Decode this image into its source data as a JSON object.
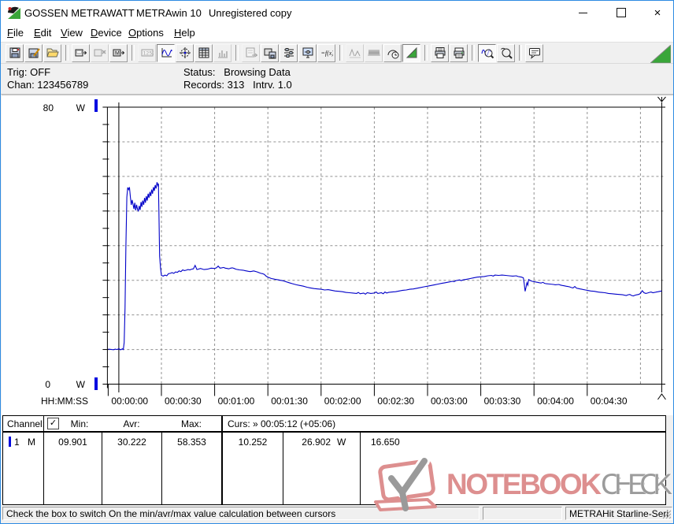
{
  "window": {
    "title_app": "GOSSEN METRAWATT",
    "title_product": "METRAwin 10",
    "title_status": "Unregistered copy"
  },
  "menu": {
    "items": [
      {
        "label": "File"
      },
      {
        "label": "Edit"
      },
      {
        "label": "View"
      },
      {
        "label": "Device"
      },
      {
        "label": "Options"
      },
      {
        "label": "Help"
      }
    ]
  },
  "toolbar": {
    "groups": [
      [
        {
          "name": "save"
        },
        {
          "name": "save-as"
        },
        {
          "name": "open"
        }
      ],
      [
        {
          "name": "device-read"
        },
        {
          "name": "device-disconnect",
          "disabled": true
        },
        {
          "name": "device-memory"
        }
      ],
      [
        {
          "name": "numeric-display",
          "disabled": true
        },
        {
          "name": "waveform-view",
          "pressed": true
        },
        {
          "name": "crosshair-view"
        },
        {
          "name": "table-view"
        },
        {
          "name": "histogram-view",
          "disabled": true
        }
      ],
      [
        {
          "name": "export",
          "disabled": true
        },
        {
          "name": "device-save"
        },
        {
          "name": "channel-settings"
        },
        {
          "name": "monitor-settings"
        },
        {
          "name": "formula"
        }
      ],
      [
        {
          "name": "minmax-curve",
          "disabled": true
        },
        {
          "name": "envelope-curve",
          "disabled": true
        },
        {
          "name": "meter-clock"
        },
        {
          "name": "live-view",
          "pressed": true
        }
      ],
      [
        {
          "name": "print-report"
        },
        {
          "name": "print"
        }
      ],
      [
        {
          "name": "zoom-time",
          "pressed": true
        },
        {
          "name": "zoom-free"
        }
      ],
      [
        {
          "name": "annotation"
        }
      ]
    ]
  },
  "info": {
    "trig": "Trig: OFF",
    "chan": "Chan: 123456789",
    "status": "Status:   Browsing Data",
    "records": "Records: 313   Intrv. 1.0"
  },
  "chart_data": {
    "type": "line",
    "xlabel": "HH:MM:SS",
    "ylabel": "W",
    "ylim": [
      0,
      80
    ],
    "xlim_seconds": [
      0,
      314
    ],
    "y_gridline_step": 10,
    "y_tick_step": 5,
    "x_tick_step_seconds": 30,
    "x_tick_labels": [
      "00:00:00",
      "00:00:30",
      "00:01:00",
      "00:01:30",
      "00:02:00",
      "00:02:30",
      "00:03:00",
      "00:03:30",
      "00:04:00",
      "00:04:30"
    ],
    "y_axis_labels": {
      "top": "80",
      "bottom": "0",
      "unit": "W"
    },
    "grid": true,
    "legend": "none",
    "cursors": {
      "cursor1_seconds": 6,
      "cursor2_seconds": 312,
      "readout": "00:05:12 (+05:06)"
    },
    "series": [
      {
        "name": "Channel 1 power (W)",
        "color": "#0000c8",
        "points": [
          [
            0,
            10.1
          ],
          [
            2,
            10.0
          ],
          [
            3,
            9.95
          ],
          [
            4,
            10.1
          ],
          [
            5,
            10.0
          ],
          [
            6,
            10.25
          ],
          [
            7,
            9.9
          ],
          [
            8,
            10.2
          ],
          [
            8.5,
            10.0
          ],
          [
            9,
            12
          ],
          [
            9.5,
            22
          ],
          [
            10,
            40
          ],
          [
            10.5,
            54
          ],
          [
            11,
            56.8
          ],
          [
            11.5,
            56.2
          ],
          [
            12,
            56.9
          ],
          [
            12.5,
            54
          ],
          [
            13,
            51.8
          ],
          [
            13.5,
            53.2
          ],
          [
            14,
            52.0
          ],
          [
            14.5,
            50.6
          ],
          [
            15,
            52.4
          ],
          [
            15.5,
            50.2
          ],
          [
            16,
            51.8
          ],
          [
            16.5,
            50.6
          ],
          [
            17,
            49.9
          ],
          [
            17.5,
            51.5
          ],
          [
            18,
            50.3
          ],
          [
            18.5,
            52.6
          ],
          [
            19,
            51.2
          ],
          [
            19.5,
            53.0
          ],
          [
            20,
            51.8
          ],
          [
            20.5,
            53.8
          ],
          [
            21,
            52.4
          ],
          [
            21.5,
            54.3
          ],
          [
            22,
            53.0
          ],
          [
            22.5,
            55.0
          ],
          [
            23,
            53.8
          ],
          [
            23.5,
            55.5
          ],
          [
            24,
            54.3
          ],
          [
            24.5,
            56.2
          ],
          [
            25,
            55.0
          ],
          [
            25.5,
            56.9
          ],
          [
            26,
            55.8
          ],
          [
            26.5,
            57.5
          ],
          [
            27,
            56.5
          ],
          [
            27.5,
            58.3
          ],
          [
            28,
            57.4
          ],
          [
            28.3,
            57.9
          ],
          [
            28.6,
            50
          ],
          [
            29,
            37
          ],
          [
            29.5,
            33.5
          ],
          [
            30,
            31.4
          ],
          [
            31,
            31.2
          ],
          [
            32,
            31.5
          ],
          [
            33,
            31.3
          ],
          [
            34,
            31.9
          ],
          [
            35,
            32.0
          ],
          [
            36,
            32.2
          ],
          [
            37,
            32.0
          ],
          [
            38,
            32.4
          ],
          [
            39,
            32.3
          ],
          [
            40,
            32.7
          ],
          [
            41,
            32.5
          ],
          [
            42,
            33.0
          ],
          [
            43,
            32.8
          ],
          [
            44,
            32.9
          ],
          [
            45,
            33.1
          ],
          [
            46,
            33.0
          ],
          [
            47,
            33.2
          ],
          [
            48,
            33.3
          ],
          [
            49,
            34.3
          ],
          [
            50,
            33.1
          ],
          [
            52,
            33.4
          ],
          [
            54,
            33.1
          ],
          [
            56,
            33.2
          ],
          [
            58,
            33.5
          ],
          [
            60,
            33.4
          ],
          [
            61,
            33.6
          ],
          [
            62,
            34.1
          ],
          [
            63,
            33.5
          ],
          [
            64,
            33.6
          ],
          [
            65,
            33.7
          ],
          [
            66,
            33.5
          ],
          [
            67,
            33.4
          ],
          [
            68,
            33.3
          ],
          [
            69,
            33.5
          ],
          [
            70,
            33.6
          ],
          [
            71,
            33.4
          ],
          [
            72,
            33.2
          ],
          [
            73,
            33.1
          ],
          [
            74,
            33.0
          ],
          [
            76,
            32.9
          ],
          [
            77,
            32.8
          ],
          [
            79,
            32.6
          ],
          [
            80,
            32.5
          ],
          [
            81,
            32.6
          ],
          [
            82,
            32.7
          ],
          [
            84,
            32.4
          ],
          [
            85,
            32.2
          ],
          [
            86,
            32.0
          ],
          [
            87,
            31.9
          ],
          [
            88,
            31.7
          ],
          [
            89,
            31.2
          ],
          [
            90,
            30.9
          ],
          [
            91,
            30.7
          ],
          [
            92,
            30.5
          ],
          [
            93,
            30.4
          ],
          [
            94,
            30.3
          ],
          [
            95,
            30.2
          ],
          [
            96,
            30.1
          ],
          [
            97,
            30.0
          ],
          [
            98,
            29.9
          ],
          [
            99,
            29.8
          ],
          [
            100,
            29.6
          ],
          [
            102,
            29.3
          ],
          [
            104,
            29.0
          ],
          [
            106,
            28.7
          ],
          [
            108,
            28.5
          ],
          [
            110,
            28.3
          ],
          [
            112,
            28.0
          ],
          [
            114,
            27.8
          ],
          [
            116,
            27.6
          ],
          [
            118,
            27.5
          ],
          [
            120,
            27.4
          ],
          [
            122,
            27.2
          ],
          [
            124,
            27.3
          ],
          [
            126,
            27.1
          ],
          [
            128,
            26.9
          ],
          [
            130,
            26.8
          ],
          [
            132,
            26.7
          ],
          [
            134,
            26.5
          ],
          [
            136,
            26.4
          ],
          [
            138,
            26.3
          ],
          [
            140,
            26.2
          ],
          [
            141,
            26.5
          ],
          [
            142,
            26.1
          ],
          [
            144,
            26.3
          ],
          [
            145,
            26.0
          ],
          [
            146,
            26.4
          ],
          [
            148,
            26.2
          ],
          [
            150,
            26.3
          ],
          [
            151,
            26.6
          ],
          [
            152,
            26.2
          ],
          [
            154,
            26.4
          ],
          [
            155,
            26.1
          ],
          [
            156,
            26.6
          ],
          [
            157,
            26.3
          ],
          [
            158,
            26.5
          ],
          [
            160,
            26.6
          ],
          [
            162,
            26.7
          ],
          [
            164,
            26.9
          ],
          [
            166,
            27.1
          ],
          [
            168,
            27.2
          ],
          [
            170,
            27.4
          ],
          [
            172,
            27.5
          ],
          [
            174,
            27.7
          ],
          [
            176,
            27.9
          ],
          [
            178,
            28.1
          ],
          [
            180,
            28.3
          ],
          [
            182,
            28.5
          ],
          [
            184,
            28.7
          ],
          [
            186,
            28.9
          ],
          [
            188,
            29.1
          ],
          [
            190,
            29.3
          ],
          [
            192,
            29.5
          ],
          [
            194,
            29.7
          ],
          [
            195,
            29.6
          ],
          [
            196,
            29.9
          ],
          [
            198,
            30.1
          ],
          [
            199,
            29.9
          ],
          [
            200,
            30.1
          ],
          [
            202,
            30.3
          ],
          [
            204,
            30.5
          ],
          [
            206,
            30.7
          ],
          [
            208,
            30.9
          ],
          [
            210,
            31.0
          ],
          [
            212,
            31.1
          ],
          [
            214,
            31.3
          ],
          [
            216,
            31.4
          ],
          [
            217,
            31.2
          ],
          [
            218,
            31.5
          ],
          [
            220,
            31.4
          ],
          [
            222,
            31.5
          ],
          [
            224,
            31.4
          ],
          [
            226,
            31.3
          ],
          [
            228,
            31.2
          ],
          [
            230,
            31.3
          ],
          [
            231,
            31.1
          ],
          [
            232,
            31.0
          ],
          [
            233,
            30.9
          ],
          [
            234,
            30.7
          ],
          [
            234.5,
            29.0
          ],
          [
            235,
            26.8
          ],
          [
            235.5,
            28.0
          ],
          [
            236,
            29.3
          ],
          [
            236.5,
            28.6
          ],
          [
            237,
            30.2
          ],
          [
            238,
            29.9
          ],
          [
            239,
            29.7
          ],
          [
            240,
            29.6
          ],
          [
            241,
            29.5
          ],
          [
            242,
            29.4
          ],
          [
            243,
            29.3
          ],
          [
            244,
            29.2
          ],
          [
            245,
            29.4
          ],
          [
            246,
            29.1
          ],
          [
            247,
            29.0
          ],
          [
            249,
            28.9
          ],
          [
            251,
            28.8
          ],
          [
            252,
            28.7
          ],
          [
            254,
            28.8
          ],
          [
            255,
            28.6
          ],
          [
            256,
            28.5
          ],
          [
            257,
            28.4
          ],
          [
            258,
            28.3
          ],
          [
            259,
            28.2
          ],
          [
            260,
            28.1
          ],
          [
            261,
            27.9
          ],
          [
            262,
            27.8
          ],
          [
            263,
            28.2
          ],
          [
            264,
            27.7
          ],
          [
            265,
            27.6
          ],
          [
            266,
            27.5
          ],
          [
            267,
            27.4
          ],
          [
            268,
            27.3
          ],
          [
            269,
            27.2
          ],
          [
            270,
            27.1
          ],
          [
            272,
            26.9
          ],
          [
            274,
            26.8
          ],
          [
            276,
            26.6
          ],
          [
            278,
            26.5
          ],
          [
            280,
            26.4
          ],
          [
            282,
            26.2
          ],
          [
            284,
            26.1
          ],
          [
            286,
            26.0
          ],
          [
            288,
            25.9
          ],
          [
            290,
            25.8
          ],
          [
            291,
            25.7
          ],
          [
            292,
            25.6
          ],
          [
            293,
            25.8
          ],
          [
            294,
            25.9
          ],
          [
            295,
            25.6
          ],
          [
            296,
            25.5
          ],
          [
            297,
            25.7
          ],
          [
            298,
            25.8
          ],
          [
            299,
            25.9
          ],
          [
            300,
            26.2
          ],
          [
            301,
            27.0
          ],
          [
            302,
            26.4
          ],
          [
            303,
            26.2
          ],
          [
            304,
            26.3
          ],
          [
            305,
            26.5
          ],
          [
            306,
            26.6
          ],
          [
            307,
            26.4
          ],
          [
            308,
            26.5
          ],
          [
            309,
            26.6
          ],
          [
            310,
            26.7
          ],
          [
            311,
            26.8
          ],
          [
            312,
            26.9
          ]
        ]
      }
    ]
  },
  "table": {
    "header": {
      "channel": "Channel:",
      "checkbox_checked": true,
      "min": "Min:",
      "avr": "Avr:",
      "max": "Max:",
      "cursor": "Curs: » 00:05:12 (+05:06)"
    },
    "row": {
      "ch": "1",
      "mode": "M",
      "min": "09.901",
      "avr": "30.222",
      "max": "58.353",
      "cur1": "10.252",
      "cur2": "26.902",
      "cur2_unit": "W",
      "diff": "16.650"
    }
  },
  "watermark": {
    "notebook": "NOTEBOOK",
    "check": "CHECK",
    "red": "#dd8f8f",
    "gray": "#9b9b9b"
  },
  "status_bar": {
    "message": "Check the box to switch On the min/avr/max value calculation between cursors",
    "device": "METRAHit Starline-Seri"
  }
}
